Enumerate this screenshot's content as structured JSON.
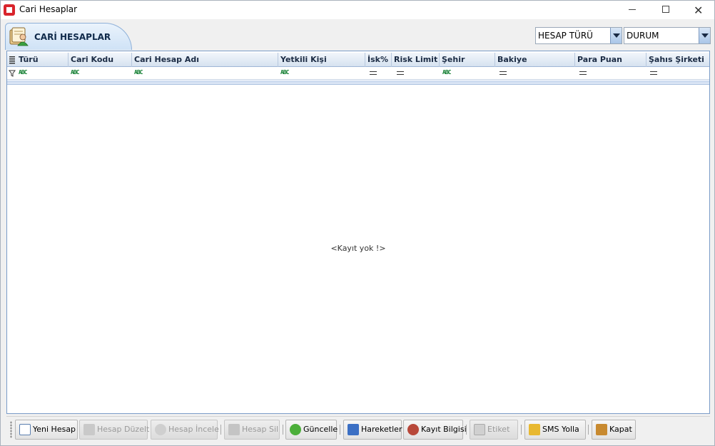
{
  "window": {
    "title": "Cari Hesaplar"
  },
  "header": {
    "tab_label": "CARİ HESAPLAR",
    "combo_hesap_turu": "HESAP  TÜRÜ",
    "combo_durum": "DURUM"
  },
  "grid": {
    "columns": [
      "Türü",
      "Cari Kodu",
      "Cari Hesap Adı",
      "Yetkili Kişi",
      "İsk%",
      "Risk Limit",
      "Şehir",
      "Bakiye",
      "Para Puan",
      "Şahıs Şirketi"
    ],
    "empty_message": "<Kayıt yok !>"
  },
  "toolbar": {
    "yeni_hesap": "Yeni Hesap",
    "hesap_duzelt": "Hesap Düzelt",
    "hesap_incele": "Hesap İncele",
    "hesap_sil": "Hesap Sil",
    "guncelle": "Güncelle",
    "hareketler": "Hareketler",
    "kayit_bilgisi": "Kayıt Bilgisi",
    "etiket": "Etiket",
    "sms_yolla": "SMS Yolla",
    "kapat": "Kapat"
  },
  "colors": {
    "accent": "#7a9cc8",
    "header_bg": "#d6e2f0",
    "app_icon": "#d9242c"
  }
}
